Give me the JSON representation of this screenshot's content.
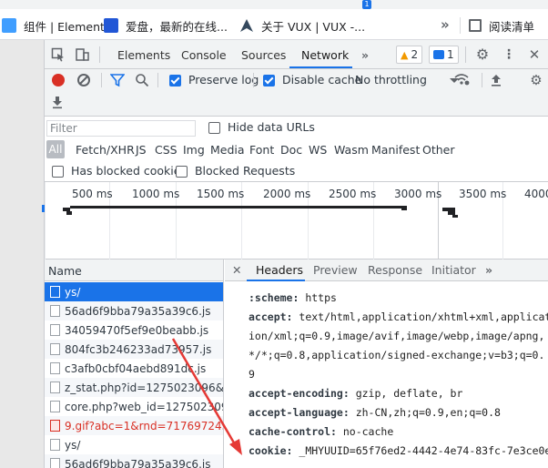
{
  "bookmarks": {
    "items": [
      {
        "label": "组件 | Element",
        "color": "#409eff"
      },
      {
        "label": "爱盘，最新的在线...",
        "color": "#2156d6"
      },
      {
        "label": "关于 VUX | VUX -...",
        "color": "#35495e"
      }
    ],
    "overflow": "»",
    "reading_list": "阅读清单",
    "notify_count": "1"
  },
  "devtools": {
    "tabs": [
      "Elements",
      "Console",
      "Sources",
      "Network"
    ],
    "more": "»",
    "warnings": "2",
    "messages": "1",
    "toolbar": {
      "preserve_log": "Preserve log",
      "disable_cache": "Disable cache",
      "throttling": "No throttling"
    },
    "filter": {
      "placeholder": "Filter",
      "hide_data_urls": "Hide data URLs",
      "types": [
        "All",
        "Fetch/XHR",
        "JS",
        "CSS",
        "Img",
        "Media",
        "Font",
        "Doc",
        "WS",
        "Wasm",
        "Manifest",
        "Other"
      ],
      "has_blocked_cookies": "Has blocked cookies",
      "blocked_requests": "Blocked Requests"
    },
    "overview": {
      "ticks": [
        "500 ms",
        "1000 ms",
        "1500 ms",
        "2000 ms",
        "2500 ms",
        "3000 ms",
        "3500 ms",
        "4000"
      ]
    },
    "requests": {
      "header": "Name",
      "items": [
        {
          "name": "ys/",
          "state": "selected"
        },
        {
          "name": "56ad6f9bba79a35a39c6.js",
          "state": ""
        },
        {
          "name": "34059470f5ef9e0beabb.js",
          "state": ""
        },
        {
          "name": "804fc3b246233ad73957.js",
          "state": ""
        },
        {
          "name": "c3afb0cbf04aebd891dc.js",
          "state": ""
        },
        {
          "name": "z_stat.php?id=1275023096&w...",
          "state": ""
        },
        {
          "name": "core.php?web_id=127502309...",
          "state": ""
        },
        {
          "name": "9.gif?abc=1&rnd=717697245",
          "state": "error"
        },
        {
          "name": "ys/",
          "state": ""
        },
        {
          "name": "56ad6f9bba79a35a39c6.js",
          "state": ""
        }
      ]
    },
    "detail": {
      "tabs": [
        "Headers",
        "Preview",
        "Response",
        "Initiator"
      ],
      "more": "»",
      "headers": [
        {
          "key": ":scheme:",
          "value": " https"
        },
        {
          "key": "accept:",
          "value": " text/html,application/xhtml+xml,applicat"
        },
        {
          "key": "",
          "value": "ion/xml;q=0.9,image/avif,image/webp,image/apng,"
        },
        {
          "key": "",
          "value": "*/*;q=0.8,application/signed-exchange;v=b3;q=0."
        },
        {
          "key": "",
          "value": "9"
        },
        {
          "key": "accept-encoding:",
          "value": " gzip, deflate, br"
        },
        {
          "key": "accept-language:",
          "value": " zh-CN,zh;q=0.9,en;q=0.8"
        },
        {
          "key": "cache-control:",
          "value": " no-cache"
        },
        {
          "key": "cookie:",
          "value": " _MHYUUID=65f76ed2-4442-4e74-83fc-7e3ce0e"
        }
      ]
    }
  }
}
